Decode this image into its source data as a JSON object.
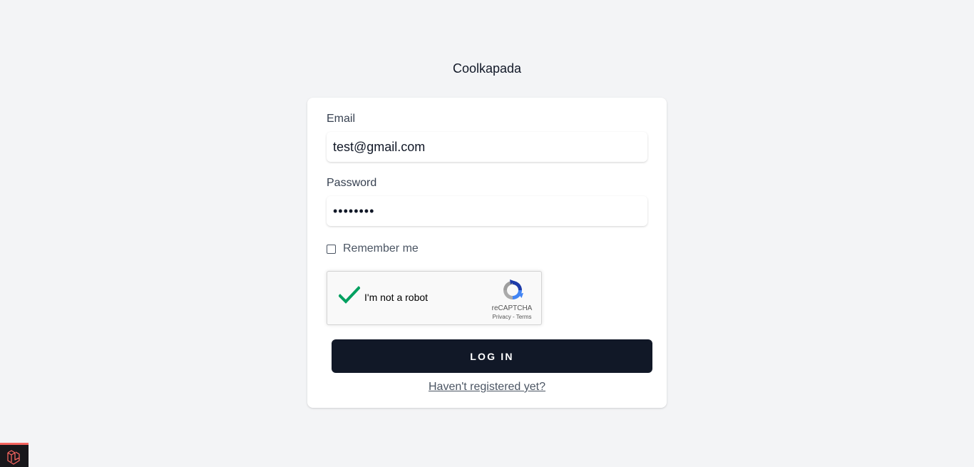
{
  "brand": {
    "name": "Coolkapada"
  },
  "form": {
    "email_label": "Email",
    "email_value": "test@gmail.com",
    "password_label": "Password",
    "password_value": "••••••••",
    "remember_label": "Remember me",
    "remember_checked": false,
    "login_label": "LOG IN",
    "register_link": "Haven't registered yet?"
  },
  "recaptcha": {
    "checked": true,
    "label": "I'm not a robot",
    "brand": "reCAPTCHA",
    "privacy": "Privacy",
    "separator": " - ",
    "terms": "Terms"
  },
  "colors": {
    "background": "#f3f4f6",
    "button": "#111827",
    "checkmark": "#00a060",
    "debug_accent": "#f4645f"
  },
  "icons": {
    "recaptcha_logo": "recaptcha-logo-icon",
    "checkmark": "checkmark-icon",
    "debugbar": "laravel-logo-icon"
  }
}
